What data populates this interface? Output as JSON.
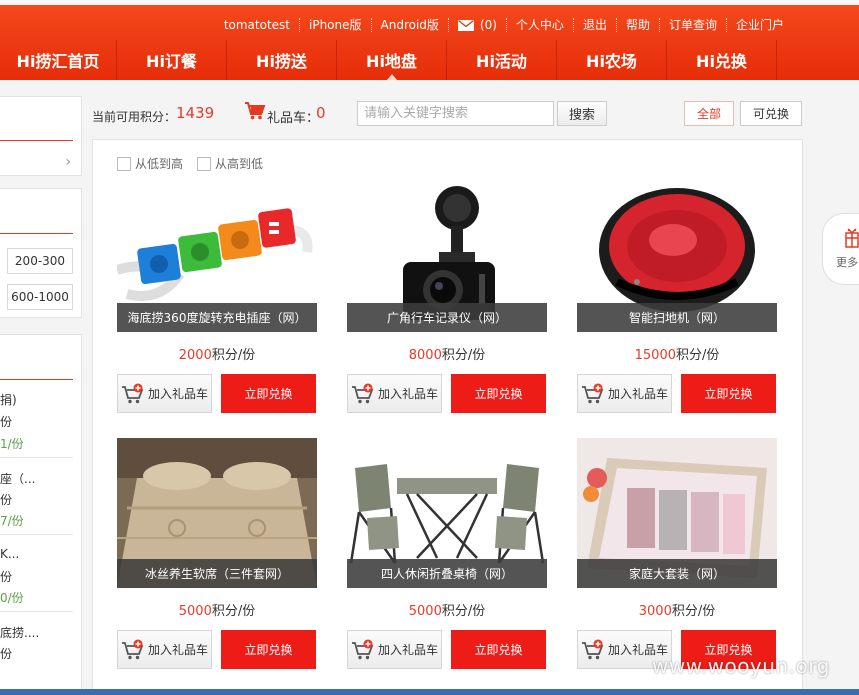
{
  "header": {
    "top_links": [
      "tomatotest",
      "iPhone版",
      "Android版"
    ],
    "mail_count": "(0)",
    "account_links": [
      "个人中心",
      "退出",
      "帮助",
      "订单查询",
      "企业门户"
    ],
    "nav": [
      {
        "label": "Hi捞汇首页",
        "active": false
      },
      {
        "label": "Hi订餐",
        "active": false
      },
      {
        "label": "Hi捞送",
        "active": false
      },
      {
        "label": "Hi地盘",
        "active": true
      },
      {
        "label": "Hi活动",
        "active": false
      },
      {
        "label": "Hi农场",
        "active": false
      },
      {
        "label": "Hi兑换",
        "active": false
      }
    ],
    "colors": {
      "header_bg": "#e83a12",
      "accent": "#ee1c16",
      "price_red": "#e63a2b"
    }
  },
  "sidebar": {
    "price_ranges": [
      "200-300",
      "600-1000"
    ],
    "partial_items": [
      {
        "name": "捐)",
        "price": "份",
        "points": "1/份"
      },
      {
        "name": "座（...",
        "price": "份",
        "points": "7/份"
      },
      {
        "name": "K...",
        "price": "份",
        "points": "0/份"
      },
      {
        "name": "底捞....",
        "price": "份",
        "points": ""
      }
    ]
  },
  "toolbar": {
    "points_label": "当前可用积分：",
    "points_value": "1439",
    "cart_label": "礼品车：",
    "cart_count": "0",
    "search_placeholder": "请输入关键字搜索",
    "search_button": "搜索",
    "filter_all": "全部",
    "filter_redeemable": "可兑换"
  },
  "sort": {
    "low_to_high": "从低到高",
    "high_to_low": "从高到低"
  },
  "products": [
    {
      "name": "海底捞360度旋转充电插座（网）",
      "points": "2000",
      "unit": "积分/份",
      "image": "power-strip"
    },
    {
      "name": "广角行车记录仪（网）",
      "points": "8000",
      "unit": "积分/份",
      "image": "dash-cam"
    },
    {
      "name": "智能扫地机（网）",
      "points": "15000",
      "unit": "积分/份",
      "image": "robot-vacuum"
    },
    {
      "name": "冰丝养生软席（三件套网）",
      "points": "5000",
      "unit": "积分/份",
      "image": "bed-mat"
    },
    {
      "name": "四人休闲折叠桌椅（网）",
      "points": "5000",
      "unit": "积分/份",
      "image": "folding-table"
    },
    {
      "name": "家庭大套装（网）",
      "points": "3000",
      "unit": "积分/份",
      "image": "towel-set"
    }
  ],
  "buttons": {
    "add_to_cart": "加入礼品车",
    "redeem_now": "立即兑换"
  },
  "float_widget": {
    "label": "更多"
  },
  "watermark": "www.wooyun.org"
}
